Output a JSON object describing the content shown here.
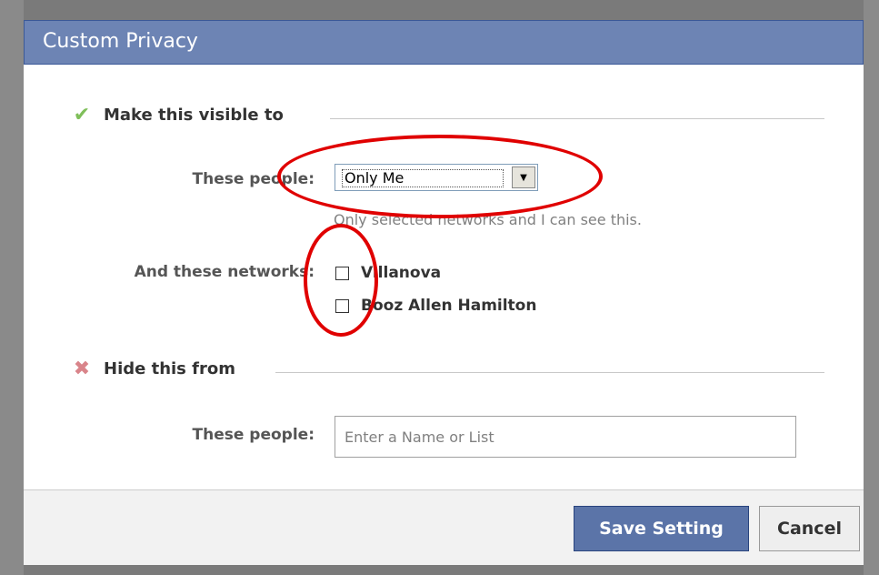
{
  "dialog": {
    "title": "Custom Privacy"
  },
  "visible_section": {
    "icon": "check-icon",
    "header": "Make this visible to",
    "people_label": "These people:",
    "people_select_value": "Only Me",
    "helper_text": "Only selected networks and I can see this.",
    "networks_label": "And these networks:",
    "networks": [
      {
        "label": "Villanova",
        "checked": false
      },
      {
        "label": "Booz Allen Hamilton",
        "checked": false
      }
    ]
  },
  "hide_section": {
    "icon": "x-icon",
    "header": "Hide this from",
    "people_label": "These people:",
    "people_input_placeholder": "Enter a Name or List",
    "people_input_value": ""
  },
  "footer": {
    "save_label": "Save Setting",
    "cancel_label": "Cancel"
  },
  "colors": {
    "titlebar": "#6d84b4",
    "save_button": "#5b74a8",
    "annotation": "#e00000"
  }
}
